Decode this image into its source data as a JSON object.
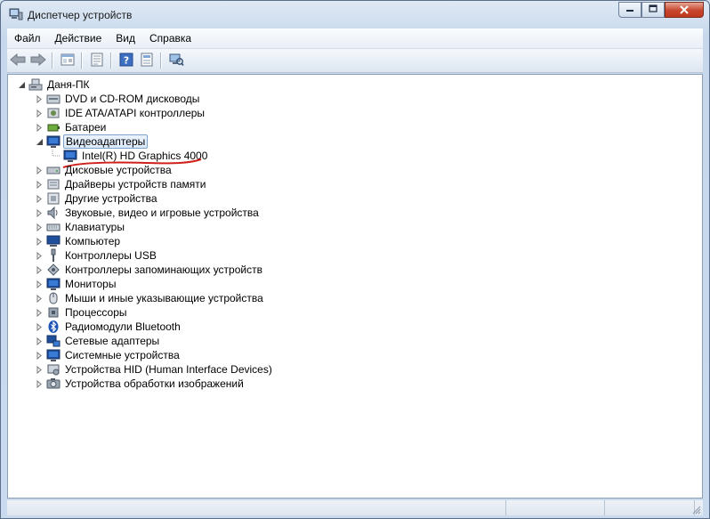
{
  "window": {
    "title": "Диспетчер устройств",
    "minimize_icon": "minimize-icon",
    "maximize_icon": "maximize-icon",
    "close_icon": "close-icon"
  },
  "menu": [
    "Файл",
    "Действие",
    "Вид",
    "Справка"
  ],
  "toolbar": {
    "buttons": [
      "back-arrow-icon",
      "forward-arrow-icon",
      "show-hide-tree-icon",
      "properties-icon",
      "help-icon",
      "scan-hardware-icon"
    ]
  },
  "tree": {
    "root": "Даня-ПК",
    "categories": [
      {
        "label": "DVD и CD-ROM дисководы",
        "icon": "dvd-drive-icon",
        "expanded": false
      },
      {
        "label": "IDE ATA/ATAPI контроллеры",
        "icon": "ide-controller-icon",
        "expanded": false
      },
      {
        "label": "Батареи",
        "icon": "battery-icon",
        "expanded": false
      },
      {
        "label": "Видеоадаптеры",
        "icon": "display-adapter-icon",
        "expanded": true,
        "selected": true,
        "children": [
          {
            "label": "Intel(R) HD Graphics 4000",
            "icon": "display-adapter-icon"
          }
        ]
      },
      {
        "label": "Дисковые устройства",
        "icon": "disk-drive-icon",
        "expanded": false
      },
      {
        "label": "Драйверы устройств памяти",
        "icon": "storage-driver-icon",
        "expanded": false
      },
      {
        "label": "Другие устройства",
        "icon": "other-devices-icon",
        "expanded": false
      },
      {
        "label": "Звуковые, видео и игровые устройства",
        "icon": "sound-icon",
        "expanded": false
      },
      {
        "label": "Клавиатуры",
        "icon": "keyboard-icon",
        "expanded": false
      },
      {
        "label": "Компьютер",
        "icon": "computer-icon",
        "expanded": false
      },
      {
        "label": "Контроллеры USB",
        "icon": "usb-icon",
        "expanded": false
      },
      {
        "label": "Контроллеры запоминающих устройств",
        "icon": "storage-controller-icon",
        "expanded": false
      },
      {
        "label": "Мониторы",
        "icon": "monitor-icon",
        "expanded": false
      },
      {
        "label": "Мыши и иные указывающие устройства",
        "icon": "mouse-icon",
        "expanded": false
      },
      {
        "label": "Процессоры",
        "icon": "processor-icon",
        "expanded": false
      },
      {
        "label": "Радиомодули Bluetooth",
        "icon": "bluetooth-icon",
        "expanded": false
      },
      {
        "label": "Сетевые адаптеры",
        "icon": "network-adapter-icon",
        "expanded": false
      },
      {
        "label": "Системные устройства",
        "icon": "system-devices-icon",
        "expanded": false
      },
      {
        "label": "Устройства HID (Human Interface Devices)",
        "icon": "hid-icon",
        "expanded": false
      },
      {
        "label": "Устройства обработки изображений",
        "icon": "imaging-devices-icon",
        "expanded": false
      }
    ]
  },
  "colors": {
    "annotation": "#d0201c",
    "selection_border": "#7da2ce"
  }
}
